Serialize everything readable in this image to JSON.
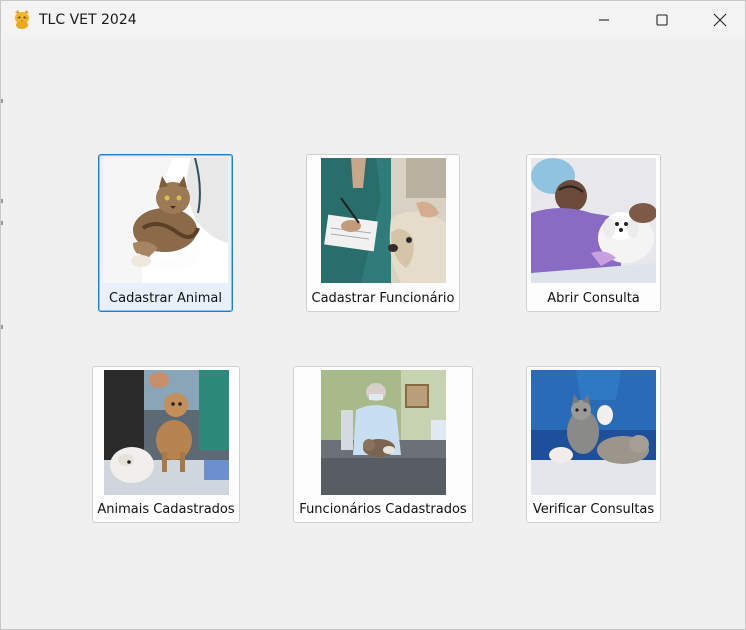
{
  "window": {
    "title": "TLC VET 2024",
    "controls": {
      "minimize": "minimize-icon",
      "maximize": "maximize-icon",
      "close": "close-icon"
    }
  },
  "tiles": [
    {
      "label": "Cadastrar Animal",
      "focused": true,
      "image": "vet-holding-cat-photo"
    },
    {
      "label": "Cadastrar Funcionário",
      "focused": false,
      "image": "vet-writing-with-dog-photo"
    },
    {
      "label": "Abrir Consulta",
      "focused": false,
      "image": "vet-examining-white-dog-photo"
    },
    {
      "label": "Animais Cadastrados",
      "focused": false,
      "image": "vets-with-poodle-and-dogs-photo"
    },
    {
      "label": "Funcionários Cadastrados",
      "focused": false,
      "image": "vet-clinic-cat-exam-photo"
    },
    {
      "label": "Verificar Consultas",
      "focused": false,
      "image": "vet-examining-cats-photo"
    }
  ],
  "colors": {
    "window_bg": "#f0f0f0",
    "focus_border": "#1c7fd6"
  }
}
